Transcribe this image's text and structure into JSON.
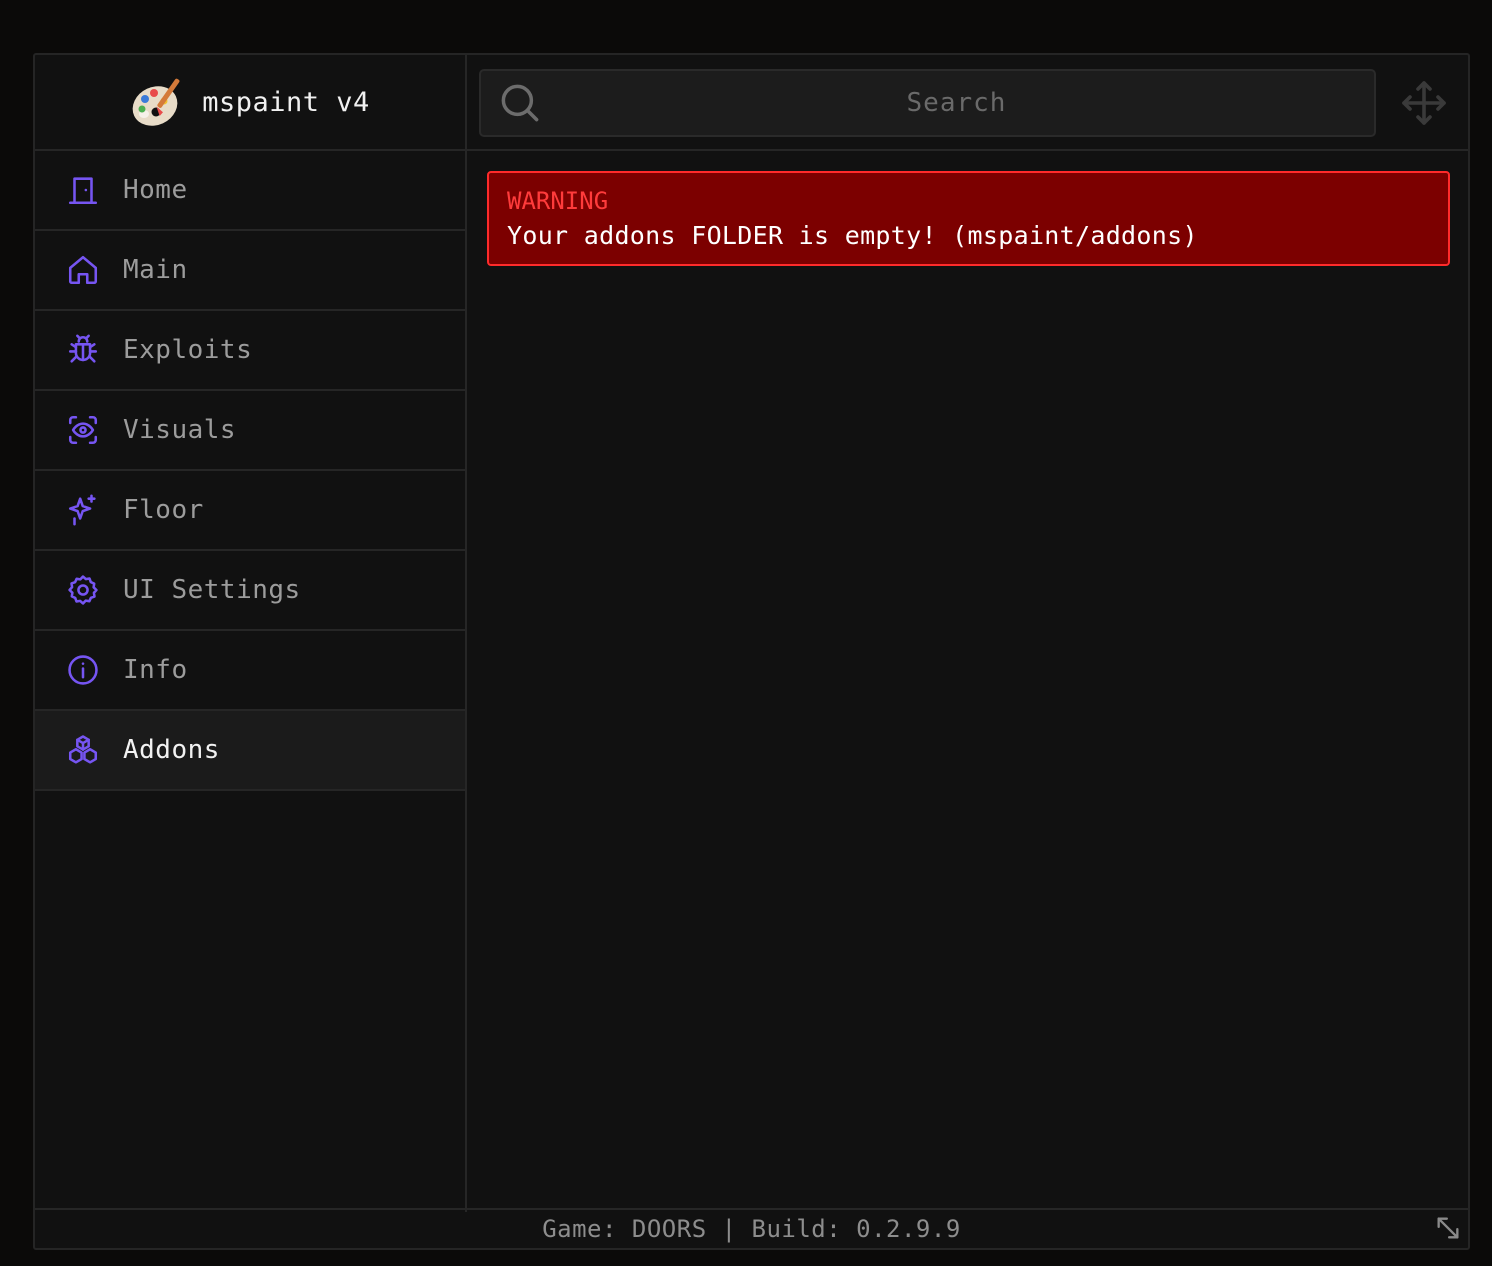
{
  "brand": {
    "title": "mspaint v4",
    "logo_icon": "palette-icon"
  },
  "accent_color": "#7655f2",
  "sidebar": {
    "items": [
      {
        "label": "Home",
        "icon": "door-icon",
        "active": false
      },
      {
        "label": "Main",
        "icon": "house-icon",
        "active": false
      },
      {
        "label": "Exploits",
        "icon": "bug-icon",
        "active": false
      },
      {
        "label": "Visuals",
        "icon": "eye-scan-icon",
        "active": false
      },
      {
        "label": "Floor",
        "icon": "sparkles-icon",
        "active": false
      },
      {
        "label": "UI Settings",
        "icon": "gear-icon",
        "active": false
      },
      {
        "label": "Info",
        "icon": "info-icon",
        "active": false
      },
      {
        "label": "Addons",
        "icon": "boxes-icon",
        "active": true
      }
    ]
  },
  "search": {
    "placeholder": "Search",
    "value": ""
  },
  "warning": {
    "title": "WARNING",
    "message": "Your addons FOLDER is empty! (mspaint/addons)",
    "bg_color": "#7c0000",
    "border_color": "#ff2b2b"
  },
  "footer": {
    "text": "Game: DOORS | Build: 0.2.9.9"
  }
}
